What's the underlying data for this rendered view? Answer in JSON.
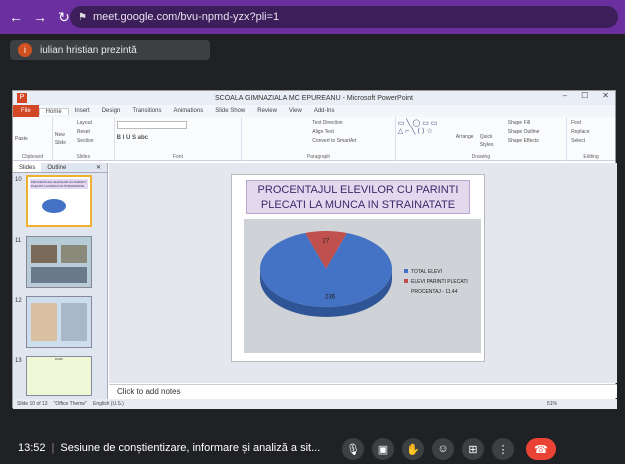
{
  "browser": {
    "url": "meet.google.com/bvu-npmd-yzx?pli=1"
  },
  "presenter": {
    "initial": "i",
    "text": "iulian hristian prezintă"
  },
  "powerpoint": {
    "window_title": "SCOALA GIMNAZIALA MC EPUREANU  -  Microsoft PowerPoint",
    "tabs": [
      "File",
      "Home",
      "Insert",
      "Design",
      "Transitions",
      "Animations",
      "Slide Show",
      "Review",
      "View",
      "Add-Ins"
    ],
    "ribbon_groups": [
      "Clipboard",
      "Slides",
      "Font",
      "Paragraph",
      "Drawing",
      "Editing"
    ],
    "ribbon": {
      "paste": "Paste",
      "new_slide": "New Slide",
      "layout": "Layout",
      "reset": "Reset",
      "section": "Section",
      "text_direction": "Text Direction",
      "align_text": "Align Text",
      "convert_smartart": "Convert to SmartArt",
      "arrange": "Arrange",
      "quick_styles": "Quick Styles",
      "shape_fill": "Shape Fill",
      "shape_outline": "Shape Outline",
      "shape_effects": "Shape Effects",
      "find": "Find",
      "replace": "Replace",
      "select": "Select"
    },
    "pane_tabs": [
      "Slides",
      "Outline"
    ],
    "thumbnails": [
      {
        "num": "10",
        "caption": "PROCENTAJUL ELEVILOR CU PARINTI PLECATI LA MUNCA IN STRAINATATE"
      },
      {
        "num": "11",
        "caption": ""
      },
      {
        "num": "12",
        "caption": ""
      },
      {
        "num": "13",
        "caption": "PARK"
      }
    ],
    "slide_title": "PROCENTAJUL ELEVILOR CU PARINTI PLECATI LA MUNCA IN STRAINATATE",
    "notes_placeholder": "Click to add notes",
    "status": {
      "slide": "Slide 10 of 13",
      "theme": "\"Office Theme\"",
      "language": "English (U.S.)",
      "zoom": "51%"
    }
  },
  "chart_data": {
    "type": "pie",
    "categories": [
      "TOTAL ELEVI",
      "ELEVI PARINTI PLECATI"
    ],
    "values": [
      236,
      27
    ],
    "data_labels": [
      "236",
      "27"
    ],
    "legend": [
      "TOTAL ELEVI",
      "ELEVI PARINTI PLECATI"
    ],
    "annotation": "PROCENTAJ - 11.44",
    "legend_position": "right",
    "colors": [
      "#4472c4",
      "#c0504d"
    ]
  },
  "meet": {
    "time": "13:52",
    "separator": "|",
    "title": "Sesiune de conștientizare, informare și analiză a sit..."
  },
  "colors": {
    "browser_bar": "#6b2fa0",
    "meet_end": "#ea4335",
    "pp_file": "#d24726"
  }
}
